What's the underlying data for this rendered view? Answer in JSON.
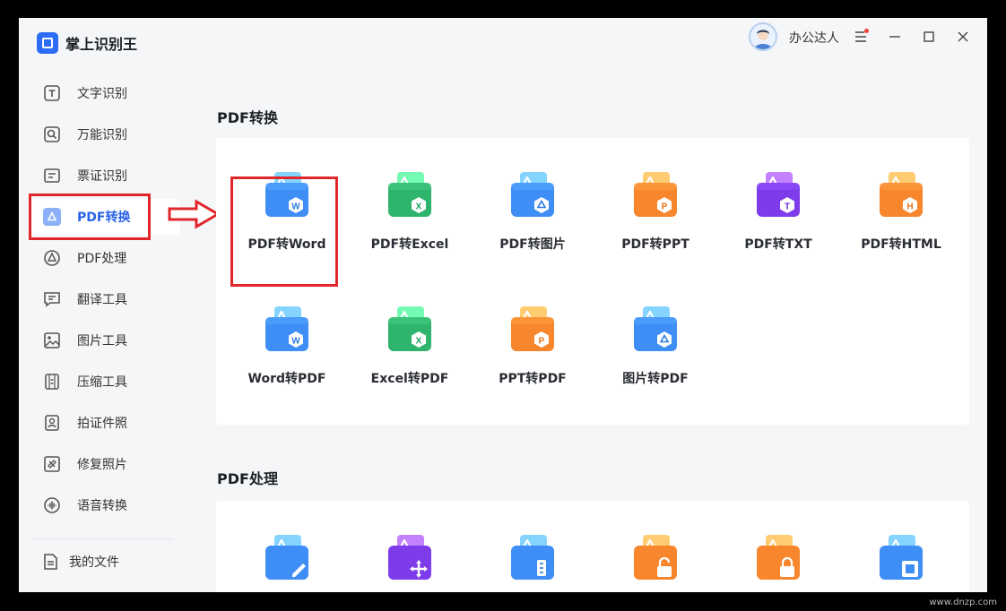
{
  "app": {
    "title": "掌上识别王"
  },
  "sidebar": {
    "items": [
      {
        "label": "文字识别",
        "icon": "text-recognition-icon"
      },
      {
        "label": "万能识别",
        "icon": "universal-recognition-icon"
      },
      {
        "label": "票证识别",
        "icon": "ticket-recognition-icon"
      },
      {
        "label": "PDF转换",
        "icon": "pdf-convert-icon",
        "active": true
      },
      {
        "label": "PDF处理",
        "icon": "pdf-process-icon"
      },
      {
        "label": "翻译工具",
        "icon": "translate-icon"
      },
      {
        "label": "图片工具",
        "icon": "image-tools-icon"
      },
      {
        "label": "压缩工具",
        "icon": "compress-icon"
      },
      {
        "label": "拍证件照",
        "icon": "id-photo-icon"
      },
      {
        "label": "修复照片",
        "icon": "repair-photo-icon"
      },
      {
        "label": "语音转换",
        "icon": "voice-convert-icon"
      }
    ],
    "footer": {
      "label": "我的文件",
      "icon": "my-files-icon"
    }
  },
  "header": {
    "user_name": "办公达人",
    "has_notification": true
  },
  "sections": [
    {
      "title": "PDF转换",
      "tiles": [
        {
          "label": "PDF转Word",
          "letter": "W",
          "color": "#3f8ef5"
        },
        {
          "label": "PDF转Excel",
          "letter": "X",
          "color": "#2eb46d"
        },
        {
          "label": "PDF转图片",
          "letter": "",
          "color": "#3f8ef5"
        },
        {
          "label": "PDF转PPT",
          "letter": "P",
          "color": "#f7862c"
        },
        {
          "label": "PDF转TXT",
          "letter": "T",
          "color": "#7d3bea"
        },
        {
          "label": "PDF转HTML",
          "letter": "H",
          "color": "#f7862c"
        },
        {
          "label": "Word转PDF",
          "letter": "W",
          "color": "#3f8ef5"
        },
        {
          "label": "Excel转PDF",
          "letter": "X",
          "color": "#2eb46d"
        },
        {
          "label": "PPT转PDF",
          "letter": "P",
          "color": "#f7862c"
        },
        {
          "label": "图片转PDF",
          "letter": "",
          "color": "#3f8ef5"
        }
      ]
    },
    {
      "title": "PDF处理",
      "tiles": [
        {
          "label": "",
          "color": "#3f8ef5"
        },
        {
          "label": "",
          "color": "#7d3bea"
        },
        {
          "label": "",
          "color": "#3f8ef5"
        },
        {
          "label": "",
          "color": "#f7862c"
        },
        {
          "label": "",
          "color": "#f7862c"
        },
        {
          "label": "",
          "color": "#3f8ef5"
        }
      ]
    }
  ],
  "watermark": "www.dnzp.com"
}
